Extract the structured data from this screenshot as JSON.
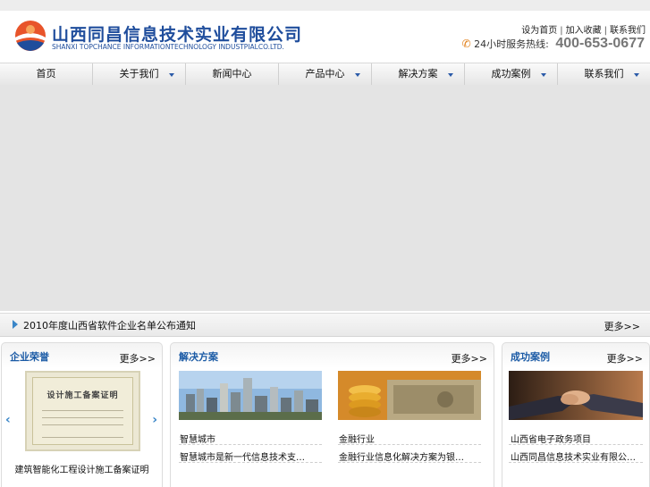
{
  "header": {
    "company_cn": "山西同昌信息技术实业有限公司",
    "company_en": "SHANXI TOPCHANCE INFORMATIONTECHNOLOGY INDUSTPIALCO.LTD.",
    "top_links": [
      "设为首页",
      "加入收藏",
      "联系我们"
    ],
    "hotline_label": "24小时服务热线:",
    "hotline_number": "400-653-0677"
  },
  "nav": {
    "items": [
      {
        "label": "首页",
        "has_dropdown": false
      },
      {
        "label": "关于我们",
        "has_dropdown": true
      },
      {
        "label": "新闻中心",
        "has_dropdown": false
      },
      {
        "label": "产品中心",
        "has_dropdown": true
      },
      {
        "label": "解决方案",
        "has_dropdown": true
      },
      {
        "label": "成功案例",
        "has_dropdown": true
      },
      {
        "label": "联系我们",
        "has_dropdown": true
      }
    ]
  },
  "newsbar": {
    "text": "2010年度山西省软件企业名单公布通知",
    "more": "更多>>"
  },
  "panels": {
    "honors": {
      "title": "企业荣誉",
      "more": "更多>>",
      "cert_heading": "设计施工备案证明",
      "caption": "建筑智能化工程设计施工备案证明"
    },
    "solutions": {
      "title": "解决方案",
      "more": "更多>>",
      "items": [
        {
          "title": "智慧城市",
          "desc": "智慧城市是新一代信息技术支撑、知识社会下一代创新环境下的城市形态"
        },
        {
          "title": "金融行业",
          "desc": "金融行业信息化解决方案为银行证券保险等机构提供安全可靠的系统建设服务"
        }
      ]
    },
    "cases": {
      "title": "成功案例",
      "more": "更多>>",
      "items": [
        {
          "title": "山西省电子政务项目",
          "desc": "山西同昌信息技术实业有限公司成功承建山西省电子政务外网建设项目"
        }
      ]
    }
  },
  "colors": {
    "brand_blue": "#1f4d9c",
    "accent_orange": "#e07b10",
    "link_blue": "#1a5aa5"
  }
}
